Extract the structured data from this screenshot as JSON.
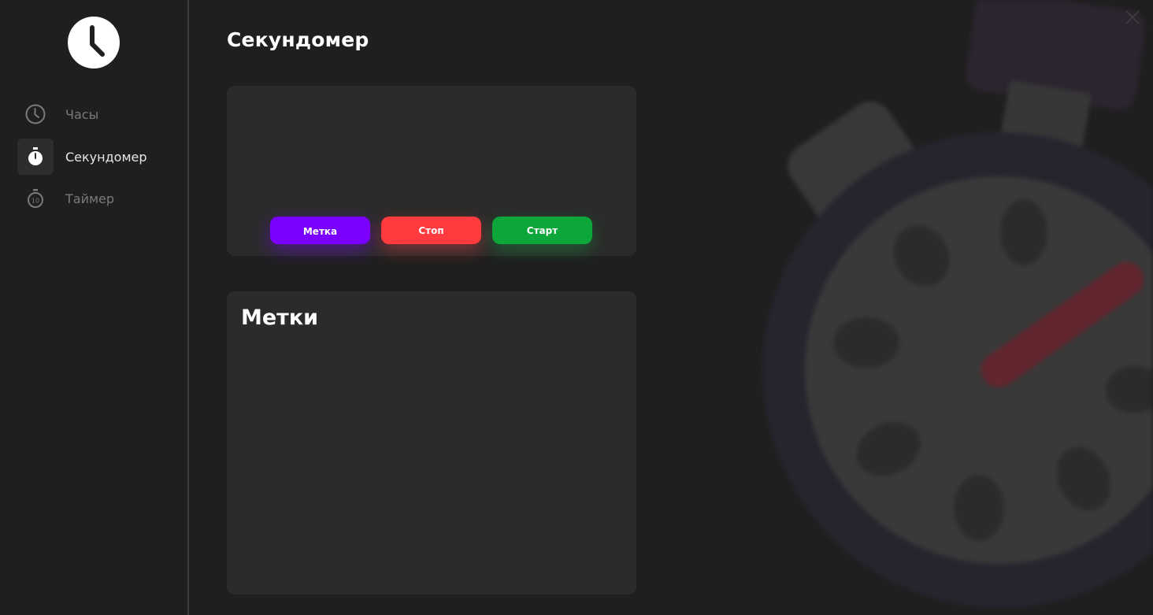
{
  "sidebar": {
    "items": [
      {
        "label": "Часы",
        "icon": "clock-icon",
        "active": false
      },
      {
        "label": "Секундомер",
        "icon": "stopwatch-icon",
        "active": true
      },
      {
        "label": "Таймер",
        "icon": "timer-icon",
        "active": false
      }
    ]
  },
  "main": {
    "title": "Секундомер",
    "buttons": {
      "lap_label": "Метка",
      "stop_label": "Стоп",
      "start_label": "Старт"
    },
    "laps": {
      "title": "Метки",
      "items": []
    }
  },
  "colors": {
    "background": "#1f1f1f",
    "card": "#2b2b2b",
    "lap_button": "#7a00ff",
    "stop_button": "#ff3b3f",
    "start_button": "#0da63a"
  }
}
